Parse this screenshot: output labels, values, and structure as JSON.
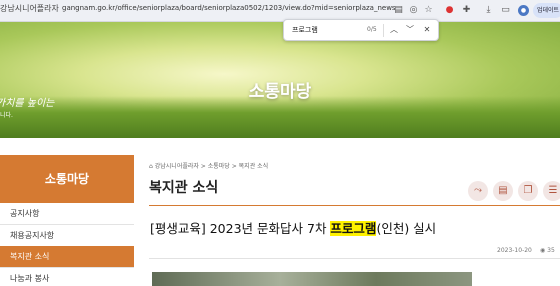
{
  "browser": {
    "logo_fragment": "강남시니어플라자",
    "url": "gangnam.go.kr/office/seniorplaza/board/seniorplaza0502/1203/view.do?mid=seniorplaza_news",
    "update_label": "업데이트"
  },
  "find": {
    "query": "프로그램",
    "count": "0/5"
  },
  "hero": {
    "title": "소통마당",
    "slogan": "가치를 높이는",
    "slogan_sub": "니다."
  },
  "sidebar": {
    "heading": "소통마당",
    "items": [
      {
        "label": "공지사항"
      },
      {
        "label": "채용공지사항"
      },
      {
        "label": "복지관 소식"
      },
      {
        "label": "나눔과 봉사"
      }
    ]
  },
  "content": {
    "breadcrumb": "강남시니어플라자 > 소통마당 > 복지관 소식",
    "section_title": "복지관 소식",
    "post": {
      "prefix": "[평생교육] 2023년 문화답사 7차 ",
      "highlight": "프로그램",
      "suffix": "(인천) 실시",
      "date": "2023-10-20",
      "views": "35"
    }
  },
  "colors": {
    "accent": "#d57a32",
    "highlight": "#fff200"
  }
}
